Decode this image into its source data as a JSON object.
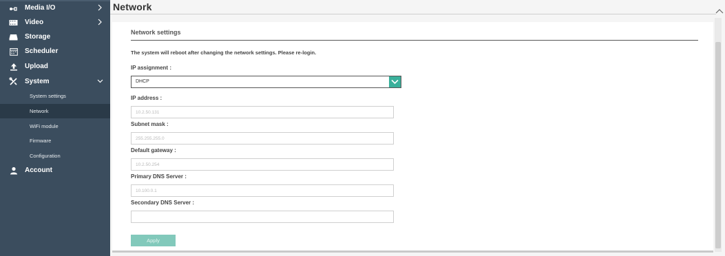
{
  "sidebar": {
    "items": [
      {
        "label": "Media I/O",
        "icon": "media-io-icon",
        "chevron": "right"
      },
      {
        "label": "Video",
        "icon": "video-icon",
        "chevron": "right"
      },
      {
        "label": "Storage",
        "icon": "storage-icon"
      },
      {
        "label": "Scheduler",
        "icon": "scheduler-icon"
      },
      {
        "label": "Upload",
        "icon": "upload-icon"
      },
      {
        "label": "System",
        "icon": "system-icon",
        "chevron": "down",
        "expanded": true
      },
      {
        "label": "Account",
        "icon": "account-icon"
      }
    ],
    "system_sub_items": [
      {
        "label": "System settings",
        "active": false
      },
      {
        "label": "Network",
        "active": true
      },
      {
        "label": "WiFi module",
        "active": false
      },
      {
        "label": "Firmware",
        "active": false
      },
      {
        "label": "Configuration",
        "active": false
      }
    ]
  },
  "page": {
    "title": "Network"
  },
  "network": {
    "section_title": "Network settings",
    "notice": "The system will reboot after changing the network settings. Please re-login.",
    "ip_assignment_label": "IP assignment :",
    "ip_assignment_value": "DHCP",
    "ip_address_label": "IP address :",
    "ip_address_value": "10.2.50.131",
    "subnet_mask_label": "Subnet mask :",
    "subnet_mask_value": "255.255.255.0",
    "default_gateway_label": "Default gateway :",
    "default_gateway_value": "10.2.50.254",
    "primary_dns_label": "Primary DNS Server :",
    "primary_dns_value": "10.100.0.1",
    "secondary_dns_label": "Secondary DNS Server :",
    "secondary_dns_value": "",
    "apply_label": "Apply"
  },
  "colors": {
    "sidebar_bg": "#3b4d5e",
    "sidebar_active": "#2a3a48",
    "accent": "#3ab09b",
    "apply_button": "#82c9bb"
  }
}
